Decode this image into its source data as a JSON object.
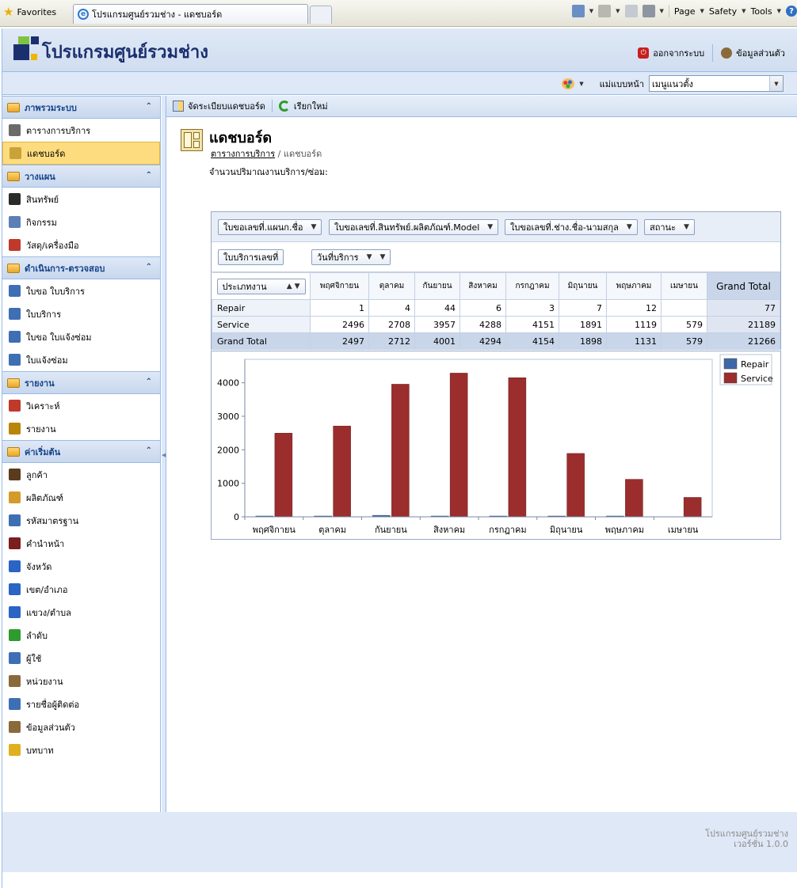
{
  "browser": {
    "favorites_label": "Favorites",
    "tab_title": "โปรแกรมศูนย์รวมช่าง - แดชบอร์ด",
    "tools": [
      "Page",
      "Safety",
      "Tools"
    ]
  },
  "header": {
    "app_title": "โปรแกรมศูนย์รวมช่าง",
    "logout_label": "ออกจากระบบ",
    "profile_label": "ข้อมูลส่วนตัว",
    "theme_label": "แม่แบบหน้า",
    "theme_value": "เมนูแนวตั้ง"
  },
  "sidebar": {
    "sections": [
      {
        "title": "ภาพรวมระบบ",
        "items": [
          {
            "label": "ตารางการบริการ",
            "icon": "clock-icon",
            "color": "#6b6b6b"
          },
          {
            "label": "แดชบอร์ด",
            "icon": "dashboard-icon",
            "color": "#c9a23a",
            "active": true
          }
        ]
      },
      {
        "title": "วางแผน",
        "items": [
          {
            "label": "สินทรัพย์",
            "icon": "asset-icon",
            "color": "#2b2b2b"
          },
          {
            "label": "กิจกรรม",
            "icon": "calendar-icon",
            "color": "#5c7fb8"
          },
          {
            "label": "วัสดุ/เครื่องมือ",
            "icon": "toolbox-icon",
            "color": "#c0392b"
          }
        ]
      },
      {
        "title": "ดำเนินการ-ตรวจสอบ",
        "items": [
          {
            "label": "ใบขอ ใบบริการ",
            "icon": "request-icon",
            "color": "#3e6fb5"
          },
          {
            "label": "ใบบริการ",
            "icon": "service-icon",
            "color": "#3e6fb5"
          },
          {
            "label": "ใบขอ ใบแจ้งซ่อม",
            "icon": "repair-request-icon",
            "color": "#3e6fb5"
          },
          {
            "label": "ใบแจ้งซ่อม",
            "icon": "repair-icon",
            "color": "#3e6fb5"
          }
        ]
      },
      {
        "title": "รายงาน",
        "items": [
          {
            "label": "วิเคราะห์",
            "icon": "analysis-icon",
            "color": "#c0392b"
          },
          {
            "label": "รายงาน",
            "icon": "report-icon",
            "color": "#b8860b"
          }
        ]
      },
      {
        "title": "ค่าเริ่มต้น",
        "items": [
          {
            "label": "ลูกค้า",
            "icon": "customer-icon",
            "color": "#5a3b1e"
          },
          {
            "label": "ผลิตภัณฑ์",
            "icon": "product-icon",
            "color": "#d49a2a"
          },
          {
            "label": "รหัสมาตรฐาน",
            "icon": "standard-code-icon",
            "color": "#3e6fb5"
          },
          {
            "label": "คำนำหน้า",
            "icon": "prefix-icon",
            "color": "#7a1e1e"
          },
          {
            "label": "จังหวัด",
            "icon": "province-icon",
            "color": "#2a64c5"
          },
          {
            "label": "เขต/อำเภอ",
            "icon": "district-icon",
            "color": "#2a64c5"
          },
          {
            "label": "แขวง/ตำบล",
            "icon": "subdistrict-icon",
            "color": "#2a64c5"
          },
          {
            "label": "ลำดับ",
            "icon": "list-icon",
            "color": "#2e9b2e"
          },
          {
            "label": "ผู้ใช้",
            "icon": "user-icon",
            "color": "#3e6fb5"
          },
          {
            "label": "หน่วยงาน",
            "icon": "department-icon",
            "color": "#8a6a3a"
          },
          {
            "label": "รายชื่อผู้ติดต่อ",
            "icon": "contact-icon",
            "color": "#3e6fb5"
          },
          {
            "label": "ข้อมูลส่วนตัว",
            "icon": "profile-icon",
            "color": "#8a6a3a"
          },
          {
            "label": "บทบาท",
            "icon": "role-icon",
            "color": "#e0b020"
          }
        ]
      }
    ]
  },
  "toolbar": {
    "arrange_label": "จัดระเบียบแดชบอร์ด",
    "refresh_label": "เรียกใหม่"
  },
  "page": {
    "title": "แดชบอร์ด",
    "breadcrumb_link": "ตารางการบริการ",
    "breadcrumb_sep": " / ",
    "breadcrumb_current": "แดชบอร์ด",
    "pivot_label": "จำนวนปริมาณงานบริการ/ซ่อม:"
  },
  "pivot": {
    "filter_fields": [
      "ใบขอเลขที่.แผนก.ชื่อ",
      "ใบขอเลขที่.สินทรัพย์.ผลิตภัณฑ์.Model",
      "ใบขอเลขที่.ช่าง.ชื่อ-นามสกุล",
      "สถานะ"
    ],
    "data_field": "ใบบริการเลขที่",
    "column_field": "วันที่บริการ",
    "row_field": "ประเภทงาน",
    "columns": [
      "พฤศจิกายน",
      "ตุลาคม",
      "กันยายน",
      "สิงหาคม",
      "กรกฎาคม",
      "มิถุนายน",
      "พฤษภาคม",
      "เมษายน"
    ],
    "grand_total_label": "Grand Total",
    "rows": [
      {
        "label": "Repair",
        "values": [
          "1",
          "4",
          "44",
          "6",
          "3",
          "7",
          "12",
          ""
        ],
        "total": "77"
      },
      {
        "label": "Service",
        "values": [
          "2496",
          "2708",
          "3957",
          "4288",
          "4151",
          "1891",
          "1119",
          "579"
        ],
        "total": "21189"
      }
    ],
    "grand_row": {
      "values": [
        "2497",
        "2712",
        "4001",
        "4294",
        "4154",
        "1898",
        "1131",
        "579"
      ],
      "total": "21266"
    }
  },
  "chart_data": {
    "type": "bar",
    "categories": [
      "พฤศจิกายน",
      "ตุลาคม",
      "กันยายน",
      "สิงหาคม",
      "กรกฎาคม",
      "มิถุนายน",
      "พฤษภาคม",
      "เมษายน"
    ],
    "series": [
      {
        "name": "Repair",
        "values": [
          1,
          4,
          44,
          6,
          3,
          7,
          12,
          0
        ],
        "color": "#3f67a8"
      },
      {
        "name": "Service",
        "values": [
          2496,
          2708,
          3957,
          4288,
          4151,
          1891,
          1119,
          579
        ],
        "color": "#9b2d2d"
      }
    ],
    "ylim": [
      0,
      4700
    ],
    "yticks": [
      0,
      1000,
      2000,
      3000,
      4000
    ],
    "grid": false,
    "legend": "top-right"
  },
  "footer": {
    "line1": "โปรแกรมศูนย์รวมช่าง",
    "line2": "เวอร์ชั่น 1.0.0"
  }
}
